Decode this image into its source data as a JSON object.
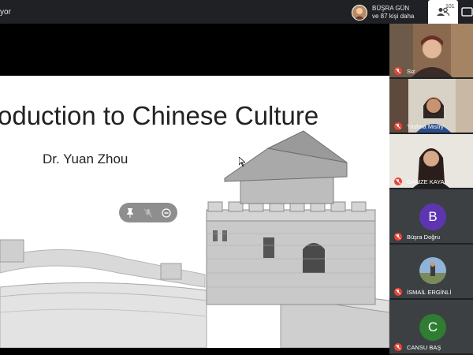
{
  "topbar": {
    "presenter_suffix": "yor",
    "notification": {
      "name": "BÜŞRA GÜN",
      "more": "ve 87 kişi daha"
    },
    "people_count": "101"
  },
  "slide": {
    "title": "roduction to Chinese Culture",
    "author": "Dr. Yuan Zhou"
  },
  "overlay_controls": [
    "pin-icon",
    "mute-icon",
    "remove-icon"
  ],
  "participants": [
    {
      "name": "Siz",
      "muted": true,
      "type": "video"
    },
    {
      "name": "Trishna Mistry",
      "muted": true,
      "type": "video"
    },
    {
      "name": "GAMZE KAYA",
      "muted": true,
      "type": "video"
    },
    {
      "name": "Büşra Doğru",
      "muted": true,
      "type": "avatar",
      "letter": "B",
      "color": "#5e35b1"
    },
    {
      "name": "İSMAİL ERGİNLİ",
      "muted": true,
      "type": "photo"
    },
    {
      "name": "CANSU BAŞ",
      "muted": true,
      "type": "avatar",
      "letter": "C",
      "color": "#2e7d32"
    }
  ],
  "colors": {
    "muted_red": "#ea4335",
    "tile_bg": "#3c4043",
    "app_bg": "#202124"
  }
}
